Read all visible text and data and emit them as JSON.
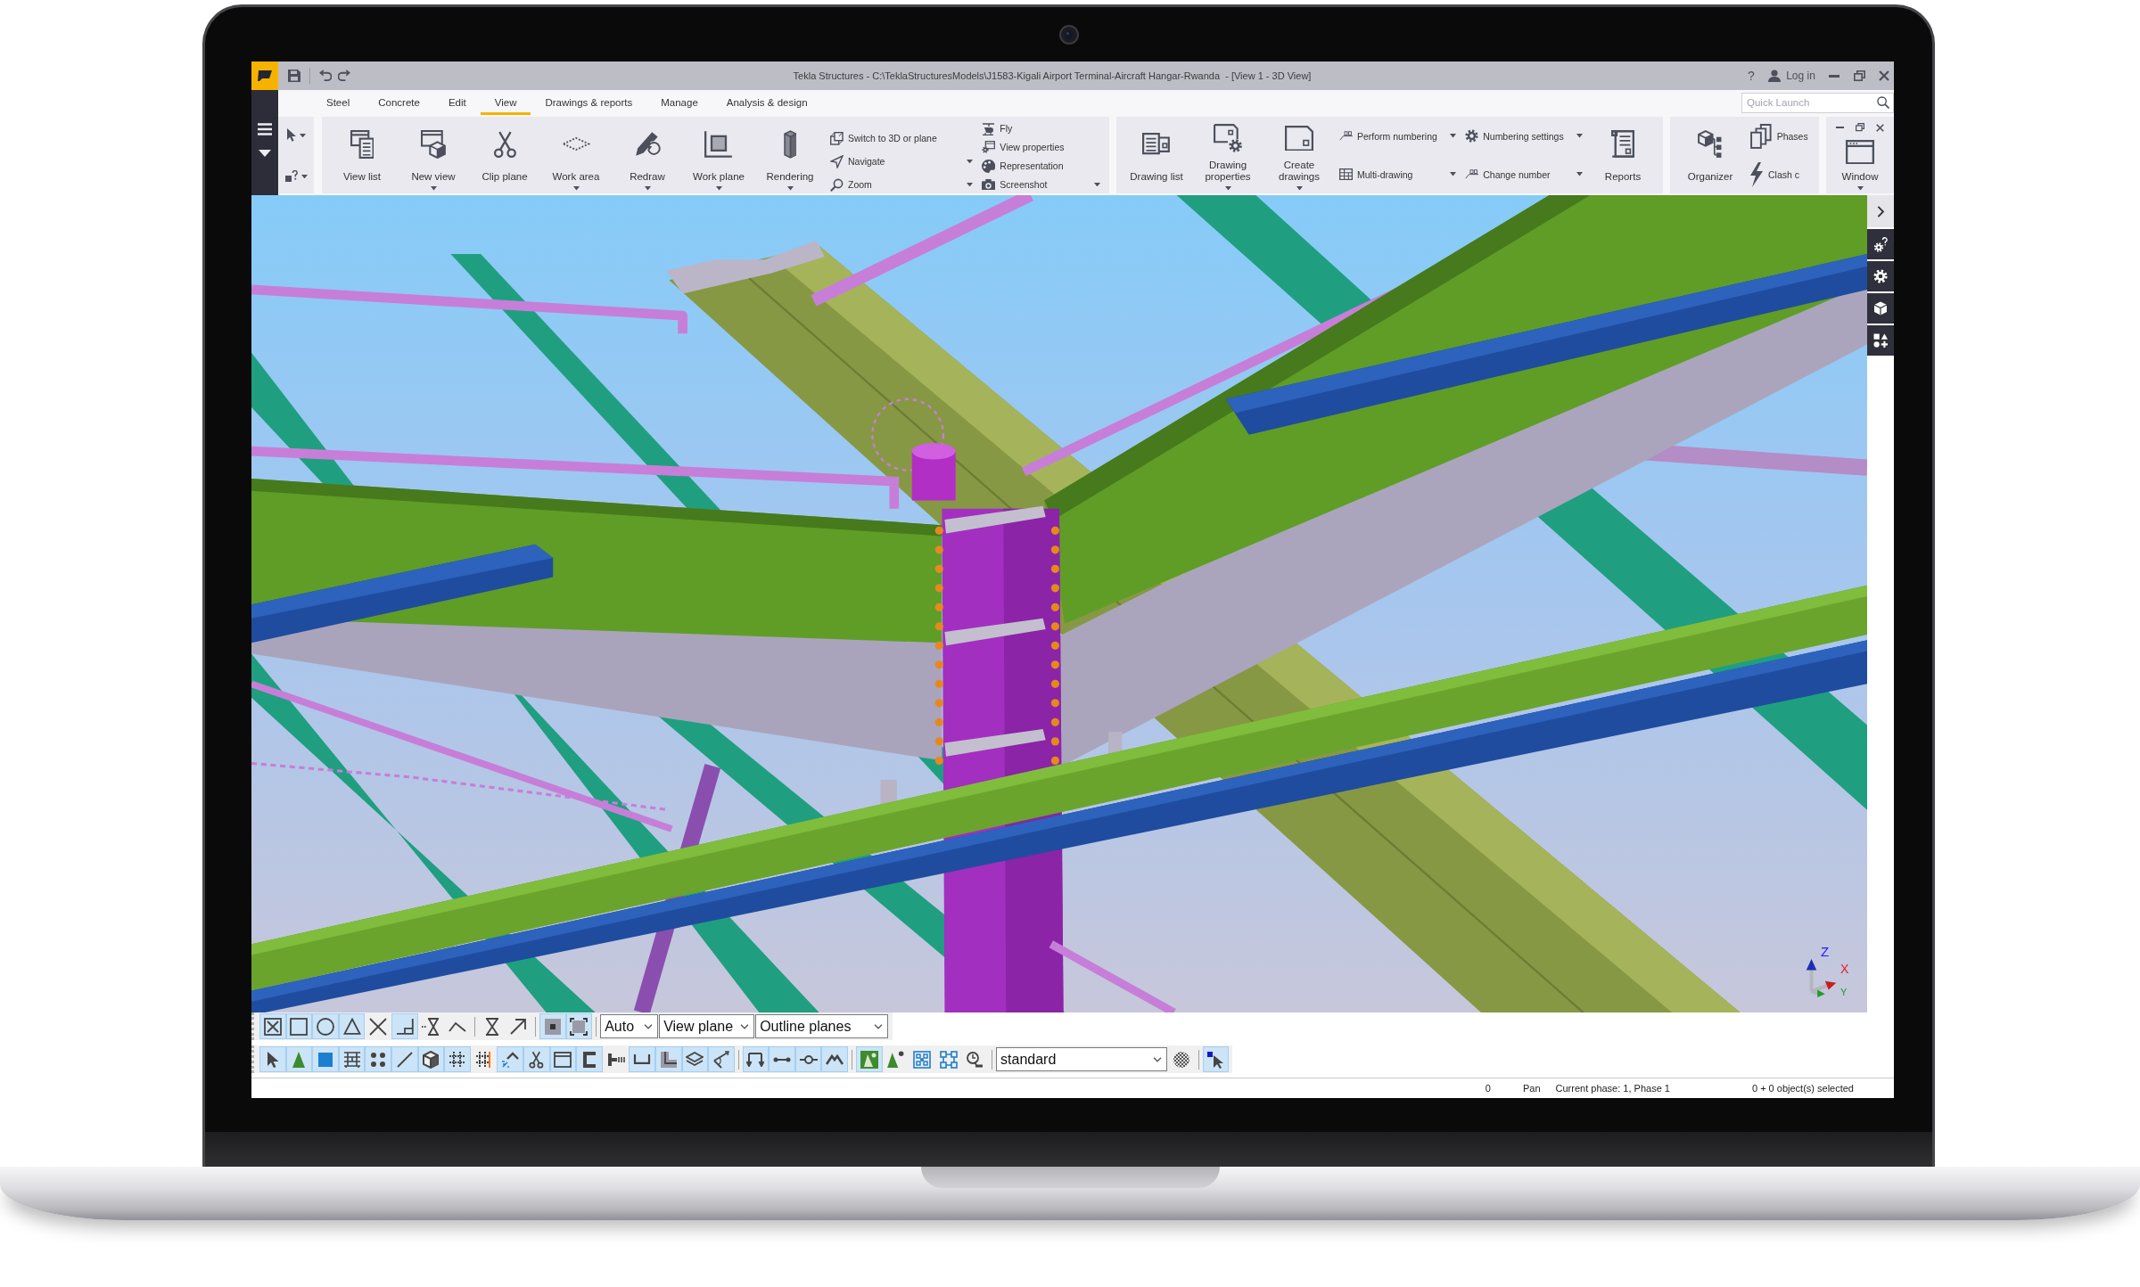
{
  "window": {
    "title": "Tekla Structures - C:\\TeklaStructuresModels\\J1583-Kigali Airport Terminal-Aircraft Hangar-Rwanda  - [View 1 - 3D View]",
    "help": "?",
    "login": "Log in"
  },
  "tabs": [
    {
      "label": "Steel",
      "selected": false
    },
    {
      "label": "Concrete",
      "selected": false
    },
    {
      "label": "Edit",
      "selected": false
    },
    {
      "label": "View",
      "selected": true
    },
    {
      "label": "Drawings & reports",
      "selected": false
    },
    {
      "label": "Manage",
      "selected": false
    },
    {
      "label": "Analysis & design",
      "selected": false
    }
  ],
  "quick_launch": {
    "placeholder": "Quick Launch"
  },
  "ribbon": {
    "groups": [
      {
        "items": [
          {
            "kind": "large",
            "label": "View list",
            "dropdown": false
          },
          {
            "kind": "large",
            "label": "New view",
            "dropdown": true
          },
          {
            "kind": "large",
            "label": "Clip plane",
            "dropdown": false
          },
          {
            "kind": "large",
            "label": "Work area",
            "dropdown": true
          },
          {
            "kind": "large",
            "label": "Redraw",
            "dropdown": true
          },
          {
            "kind": "large",
            "label": "Work plane",
            "dropdown": true
          },
          {
            "kind": "large",
            "label": "Rendering",
            "dropdown": true
          },
          {
            "kind": "column",
            "entries": [
              {
                "label": "Switch to 3D or plane",
                "dropdown": false
              },
              {
                "label": "Navigate",
                "dropdown": true
              },
              {
                "label": "Zoom",
                "dropdown": true
              }
            ]
          },
          {
            "kind": "column",
            "entries": [
              {
                "label": "Fly",
                "dropdown": false
              },
              {
                "label": "View properties",
                "dropdown": false
              },
              {
                "label": "Representation",
                "dropdown": false
              },
              {
                "label": "Screenshot",
                "dropdown": true
              }
            ]
          }
        ]
      },
      {
        "items": [
          {
            "kind": "large",
            "label": "Drawing list",
            "dropdown": false
          },
          {
            "kind": "large",
            "label": "Drawing properties",
            "dropdown": true
          },
          {
            "kind": "large",
            "label": "Create drawings",
            "dropdown": true
          },
          {
            "kind": "column",
            "entries": [
              {
                "label": "Perform numbering",
                "dropdown": true
              },
              {
                "label": "Multi-drawing",
                "dropdown": true
              }
            ]
          },
          {
            "kind": "column",
            "entries": [
              {
                "label": "Numbering settings",
                "dropdown": true
              },
              {
                "label": "Change number",
                "dropdown": true
              }
            ]
          },
          {
            "kind": "large",
            "label": "Reports",
            "dropdown": false
          }
        ]
      },
      {
        "items": [
          {
            "kind": "large",
            "label": "Organizer",
            "dropdown": false
          },
          {
            "kind": "stack",
            "entries": [
              {
                "label": "Phases",
                "dropdown": false
              },
              {
                "label": "Clash c",
                "dropdown": false
              }
            ]
          }
        ]
      },
      {
        "items": [
          {
            "kind": "large",
            "label": "Window",
            "dropdown": true
          }
        ]
      }
    ]
  },
  "model_view": {
    "axis_labels": [
      "Z",
      "X",
      "Y"
    ]
  },
  "toolbars": [
    {
      "groups": [
        [
          {
            "kind": "toggle",
            "on": true
          },
          {
            "kind": "toggle",
            "on": true
          },
          {
            "kind": "toggle",
            "on": true
          },
          {
            "kind": "toggle",
            "on": true
          },
          {
            "kind": "toggle",
            "on": false
          },
          {
            "kind": "toggle",
            "on": true
          },
          {
            "kind": "toggle",
            "on": false
          },
          {
            "kind": "toggle",
            "on": false
          }
        ],
        [
          {
            "kind": "toggle",
            "on": false
          },
          {
            "kind": "toggle",
            "on": false
          }
        ],
        [
          {
            "kind": "toggle",
            "on": true
          },
          {
            "kind": "toggle",
            "on": true
          }
        ],
        [
          {
            "kind": "dropdown",
            "value": "Auto"
          },
          {
            "kind": "dropdown",
            "value": "View plane"
          },
          {
            "kind": "dropdown",
            "value": "Outline planes"
          }
        ]
      ]
    },
    {
      "groups": [
        [
          {
            "kind": "toggle",
            "on": true
          },
          {
            "kind": "toggle",
            "on": true
          },
          {
            "kind": "toggle",
            "on": true
          },
          {
            "kind": "toggle",
            "on": true
          },
          {
            "kind": "toggle",
            "on": true
          },
          {
            "kind": "toggle",
            "on": true
          },
          {
            "kind": "toggle",
            "on": true
          },
          {
            "kind": "toggle",
            "on": true
          },
          {
            "kind": "toggle",
            "on": false
          },
          {
            "kind": "toggle",
            "on": true
          },
          {
            "kind": "toggle",
            "on": true
          },
          {
            "kind": "toggle",
            "on": true
          },
          {
            "kind": "toggle",
            "on": true
          },
          {
            "kind": "toggle",
            "on": false
          },
          {
            "kind": "toggle",
            "on": true
          },
          {
            "kind": "toggle",
            "on": true
          },
          {
            "kind": "toggle",
            "on": true
          },
          {
            "kind": "toggle",
            "on": true
          }
        ],
        [
          {
            "kind": "toggle",
            "on": true
          },
          {
            "kind": "toggle",
            "on": true
          },
          {
            "kind": "toggle",
            "on": true
          },
          {
            "kind": "toggle",
            "on": true
          }
        ],
        [
          {
            "kind": "toggle",
            "on": true
          },
          {
            "kind": "toggle",
            "on": false
          },
          {
            "kind": "toggle",
            "on": false
          },
          {
            "kind": "toggle",
            "on": false
          },
          {
            "kind": "toggle",
            "on": false
          }
        ],
        [
          {
            "kind": "dropdown",
            "value": "standard"
          },
          {
            "kind": "toggle",
            "on": false
          }
        ],
        [
          {
            "kind": "toggle",
            "on": true
          }
        ]
      ]
    }
  ],
  "status_bar": [
    "0",
    "Pan",
    "Current phase: 1, Phase 1",
    "0 + 0 object(s) selected"
  ]
}
